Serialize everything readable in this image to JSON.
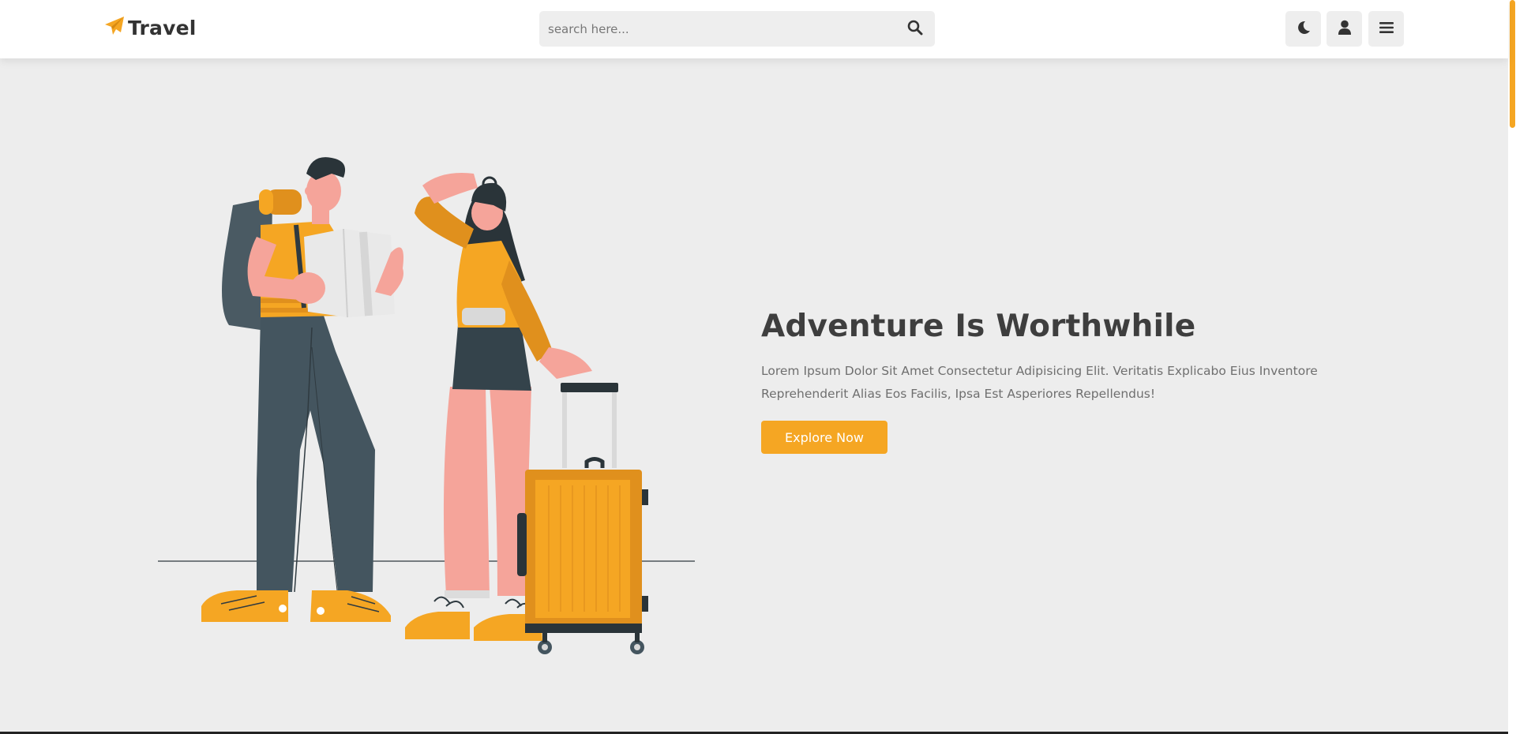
{
  "header": {
    "logo_text": "Travel",
    "logo_icon": "paper-plane-icon",
    "search": {
      "placeholder": "search here...",
      "icon": "search-icon"
    },
    "buttons": [
      {
        "name": "theme-toggle",
        "icon": "moon-icon"
      },
      {
        "name": "login",
        "icon": "user-icon"
      },
      {
        "name": "menu",
        "icon": "bars-icon"
      }
    ]
  },
  "hero": {
    "title": "Adventure Is Worthwhile",
    "text": "Lorem Ipsum Dolor Sit Amet Consectetur Adipisicing Elit. Veritatis Explicabo Eius Inventore Reprehenderit Alias Eos Facilis, Ipsa Est Asperiores Repellendus!",
    "button_label": "Explore Now",
    "illustration": "travelers-illustration"
  },
  "colors": {
    "accent": "#f5a623",
    "background": "#ededed",
    "header_bg": "#ffffff",
    "text_dark": "#3e3e3e",
    "text_muted": "#6f6f6f"
  }
}
